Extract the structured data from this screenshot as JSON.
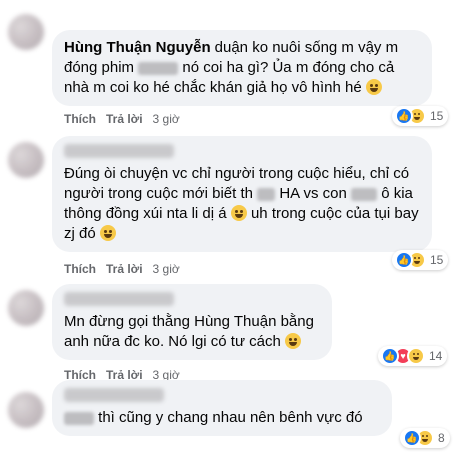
{
  "comments": [
    {
      "author": "Hùng Thuận Nguyễn",
      "text_before": "duận ko nuôi sống m vậy m đóng phim",
      "text_after": "nó coi ha gì? Ủa m đóng cho cả nhà m coi ko hé chắc khán giả họ vô hình hé",
      "reactions": [
        "like",
        "haha"
      ],
      "reaction_count": "15"
    },
    {
      "author": "",
      "text_before": "Đúng òi chuyện vc chỉ người trong cuộc hiểu, chỉ có người trong cuộc mới biết th",
      "text_mid": "HA vs con",
      "text_after": "ô kia thông đồng xúi nta li dị á",
      "text_end": "uh trong cuộc của tụi bay zj đó",
      "reactions": [
        "like",
        "haha"
      ],
      "reaction_count": "15"
    },
    {
      "author": "",
      "text_before": "Mn đừng gọi thằng Hùng Thuận bằng anh nữa đc ko. Nó lgi có tư cách",
      "reactions": [
        "like",
        "love",
        "haha"
      ],
      "reaction_count": "14"
    },
    {
      "author": "",
      "text_before": "thì cũng y chang nhau nên bênh vực đó",
      "reactions": [
        "like",
        "haha"
      ],
      "reaction_count": "8"
    }
  ],
  "actions": {
    "like_label": "Thích",
    "reply_label": "Trả lời",
    "time": "3 giờ"
  },
  "icons": {
    "like": "like-reaction-icon",
    "haha": "haha-reaction-icon",
    "love": "love-reaction-icon",
    "emoji": "laughing-emoji-icon"
  },
  "colors": {
    "bubble": "#f0f2f5",
    "meta_text": "#65676b",
    "like_blue": "#1877f2",
    "haha_yellow": "#f7c948",
    "love_red": "#f33e58"
  }
}
